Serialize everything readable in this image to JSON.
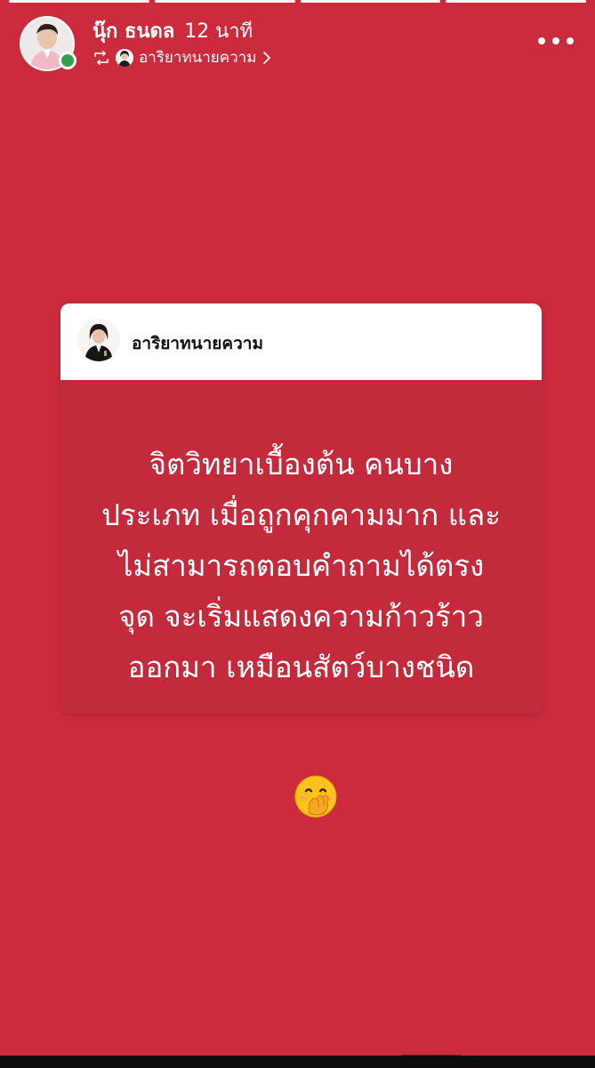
{
  "story": {
    "author": "นุ๊ก ธนดล",
    "time_ago": "12 นาที",
    "shared_from": "อาริยาทนายความ",
    "progress_count": 4
  },
  "card": {
    "author": "อาริยาทนายความ",
    "lines": [
      "จิตวิทยาเบื้องต้น คนบาง",
      "ประเภท เมื่อถูกคุกคามมาก และ",
      "ไม่สามารถตอบคำถามได้ตรง",
      "จุด จะเริ่มแสดงความก้าวร้าว",
      "ออกมา เหมือนสัตว์บางชนิด"
    ]
  },
  "icons": {
    "repost": "repost-icon",
    "chevron": "chevron-right-icon",
    "more": "more-icon",
    "emoji": "face-with-hand-over-mouth-emoji"
  },
  "colors": {
    "background": "#cc2b3e",
    "card_body": "#c32a3b",
    "online": "#31a24c"
  }
}
